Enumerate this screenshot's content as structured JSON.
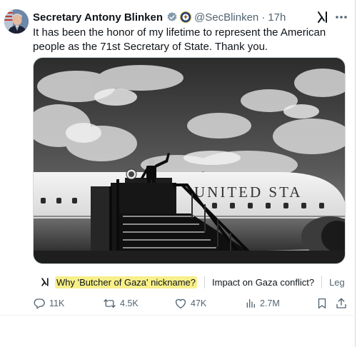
{
  "tweet": {
    "author_name": "Secretary Antony Blinken",
    "handle": "@SecBlinken",
    "separator": "·",
    "time": "17h",
    "text": "It has been the honor of my lifetime to represent the American people as the 71st Secretary of State. Thank you.",
    "icons": {
      "verified": "verified-badge-icon",
      "affiliation": "state-department-seal-icon",
      "grok": "grok-icon",
      "more": "more-options-icon"
    }
  },
  "media": {
    "fuselage_text": "UNITED STA"
  },
  "suggestions": [
    {
      "label": "Why 'Butcher of Gaza' nickname?"
    },
    {
      "label": "Impact on Gaza conflict?"
    },
    {
      "label": "Leg"
    }
  ],
  "actions": {
    "replies": "11K",
    "reposts": "4.5K",
    "likes": "47K",
    "views": "2.7M"
  },
  "colors": {
    "text": "#0f1419",
    "secondary": "#536471",
    "verified_blue": "#1d9bf0",
    "highlight": "#f7f08a"
  }
}
